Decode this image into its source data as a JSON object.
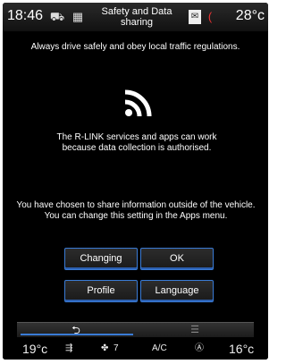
{
  "status_bar": {
    "time": "18:46",
    "title": "Safety and Data sharing",
    "temperature": "28°c",
    "icons": [
      "car-icon",
      "radio-icon",
      "phone-icon",
      "battery-icon"
    ]
  },
  "content": {
    "safety_text": "Always drive safely and obey local traffic regulations.",
    "icon": "wifi-signal-icon",
    "services_text": "The R-LINK services and apps can work because data collection is authorised.",
    "share_text": "You have chosen to share information outside of the vehicle. You can change this setting in the Apps menu."
  },
  "buttons": {
    "changing": "Changing",
    "ok": "OK",
    "profile": "Profile",
    "language": "Language"
  },
  "nav": {
    "back_icon": "back-arrow-icon",
    "menu_icon": "menu-icon"
  },
  "climate": {
    "left_temp": "19°c",
    "fan_level": "7",
    "ac": "A/C",
    "right_temp": "16°c"
  },
  "colors": {
    "accent": "#3a7bd5",
    "background": "#000000"
  }
}
